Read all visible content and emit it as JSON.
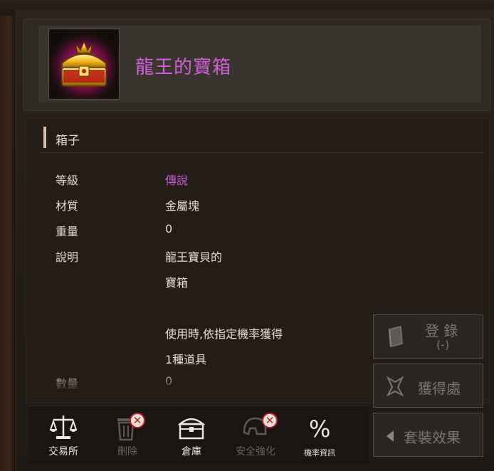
{
  "item": {
    "name": "龍王的寶箱",
    "icon": "treasure-chest-icon",
    "category": "箱子"
  },
  "attributes": [
    {
      "label": "等級",
      "value": "傳說"
    },
    {
      "label": "材質",
      "value": "金屬塊"
    },
    {
      "label": "重量",
      "value": "0"
    },
    {
      "label": "說明",
      "value": "龍王寶貝的"
    }
  ],
  "description_lines": [
    "寶箱",
    "使用時,依指定機率獲得",
    "1種道具"
  ],
  "cut_off_row": {
    "label": "數量",
    "value": "0"
  },
  "side_buttons": {
    "register": {
      "label": "登 錄",
      "sub": "(-)",
      "icon": "book-icon"
    },
    "obtain": {
      "label": "獲得處",
      "icon": "location-icon"
    },
    "set_effect": {
      "label": "套裝效果",
      "icon": "triangle-left-icon"
    }
  },
  "toolbar": [
    {
      "label": "交易所",
      "icon": "scales-icon",
      "disabled": false
    },
    {
      "label": "刪除",
      "icon": "trash-icon",
      "disabled": true
    },
    {
      "label": "倉庫",
      "icon": "chest-icon",
      "disabled": false
    },
    {
      "label": "安全強化",
      "icon": "helmet-icon",
      "disabled": true
    },
    {
      "label": "機率資訊",
      "icon": "percent-icon",
      "disabled": false
    }
  ],
  "colors": {
    "legend_purple": "#c75bd6",
    "title_purple": "#d25fdc",
    "background": "#231c17"
  }
}
